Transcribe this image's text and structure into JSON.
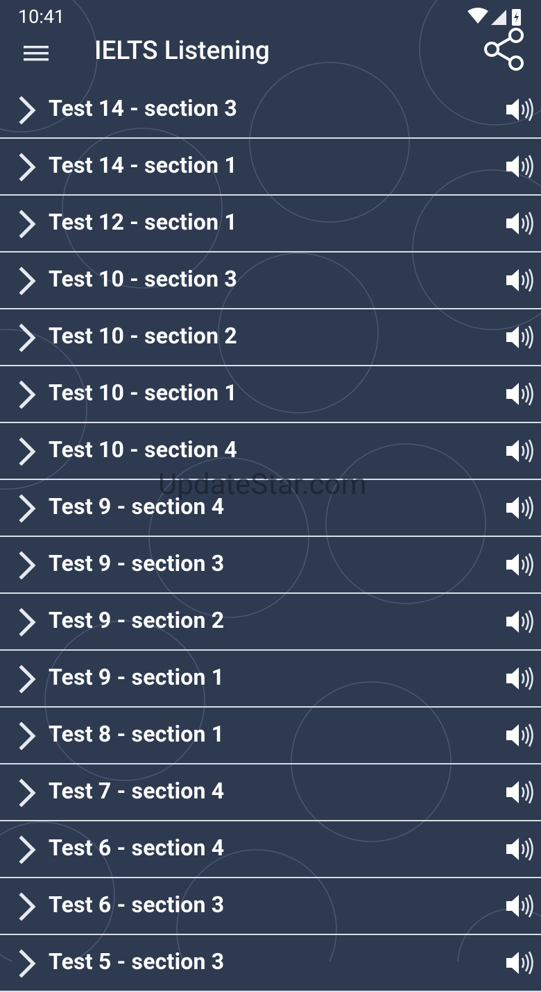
{
  "status_bar": {
    "time": "10:41"
  },
  "app_bar": {
    "title": "IELTS Listening"
  },
  "items": [
    {
      "label": "Test 14 - section 3"
    },
    {
      "label": "Test 14 - section 1"
    },
    {
      "label": "Test 12 - section 1"
    },
    {
      "label": "Test 10 - section 3"
    },
    {
      "label": "Test 10 - section 2"
    },
    {
      "label": "Test 10 - section 1"
    },
    {
      "label": "Test 10 - section 4"
    },
    {
      "label": "Test 9 - section 4"
    },
    {
      "label": "Test 9 - section 3"
    },
    {
      "label": "Test 9 - section 2"
    },
    {
      "label": "Test 9 - section 1"
    },
    {
      "label": "Test 8 - section 1"
    },
    {
      "label": "Test 7 - section 4"
    },
    {
      "label": "Test 6 - section 4"
    },
    {
      "label": "Test 6 - section 3"
    },
    {
      "label": "Test 5 - section 3"
    }
  ],
  "watermark": "UpdateStar.com",
  "colors": {
    "background": "#2e3a50",
    "divider": "#d8dee6",
    "text": "#ffffff"
  },
  "icons": {
    "menu": "hamburger-menu-icon",
    "share": "share-icon",
    "row_chevron": "chevron-right-icon",
    "row_audio": "speaker-volume-icon"
  }
}
